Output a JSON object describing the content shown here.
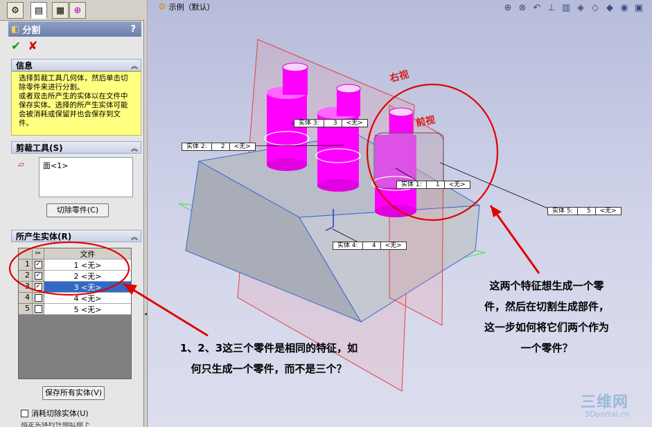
{
  "panel": {
    "title": "分割",
    "help": "?",
    "info": {
      "header": "信息",
      "lines": [
        "选择剪裁工具几何体，然后单击切除零件来进行分割。",
        "或者双击所产生的实体以在文件中保存实体。选择的所产生实体可能会被消耗或保留并也会保存到文件。"
      ]
    },
    "cut_tools": {
      "header": "剪裁工具(S)",
      "list_item": "面<1>",
      "button": "切除零件(C)"
    },
    "bodies": {
      "header": "所产生实体(R)",
      "column_file": "文件",
      "rows": [
        {
          "num": "1",
          "file": "1 <无>",
          "checked": true,
          "selected": false
        },
        {
          "num": "2",
          "file": "2 <无>",
          "checked": true,
          "selected": false
        },
        {
          "num": "3",
          "file": "3 <无>",
          "checked": true,
          "selected": true
        },
        {
          "num": "4",
          "file": "4 <无>",
          "checked": false,
          "selected": false
        },
        {
          "num": "5",
          "file": "5 <无>",
          "checked": false,
          "selected": false
        }
      ]
    },
    "save_all_button": "保存所有实体(V)",
    "consume_label": "消耗切除实体(U)",
    "cutoff_text": "指定实体时件顺缸顺下"
  },
  "viewport": {
    "tree_title": "示例（默认）",
    "view_labels": {
      "right": "右视",
      "front": "前视"
    },
    "callouts": [
      {
        "a": "实体  1:",
        "b": "1",
        "c": "<无>"
      },
      {
        "a": "实体  2:",
        "b": "2",
        "c": "<无>"
      },
      {
        "a": "实体  3:",
        "b": "3",
        "c": "<无>"
      },
      {
        "a": "实体  4:",
        "b": "4",
        "c": "<无>"
      },
      {
        "a": "实体  5:",
        "b": "5",
        "c": "<无>"
      }
    ],
    "annotations": {
      "left_note": [
        "1、2、3这三个零件是相同的特征，如",
        "何只生成一个零件，而不是三个？"
      ],
      "right_note": [
        "这两个特征想生成一个零",
        "件，然后在切割生成部件，",
        "这一步如何将它们两个作为",
        "一个零件？"
      ]
    },
    "watermark": {
      "main": "三维网",
      "sub": "3Dportal.cn"
    }
  },
  "colors": {
    "annotation_red": "#e00000",
    "part_magenta": "#ff00ff",
    "plane_red": "#e04040",
    "accent_blue": "#316ac5"
  },
  "icons": {
    "tabs": [
      "feature-manager-icon",
      "property-manager-icon",
      "configuration-manager-icon",
      "dimxpert-icon"
    ],
    "toolbar": [
      "zoom-fit-icon",
      "zoom-area-icon",
      "previous-view-icon",
      "section-view-icon",
      "view-orientation-icon",
      "display-style-icon",
      "hide-show-icon",
      "edit-appearance-icon",
      "scene-icon",
      "view-settings-icon"
    ]
  }
}
